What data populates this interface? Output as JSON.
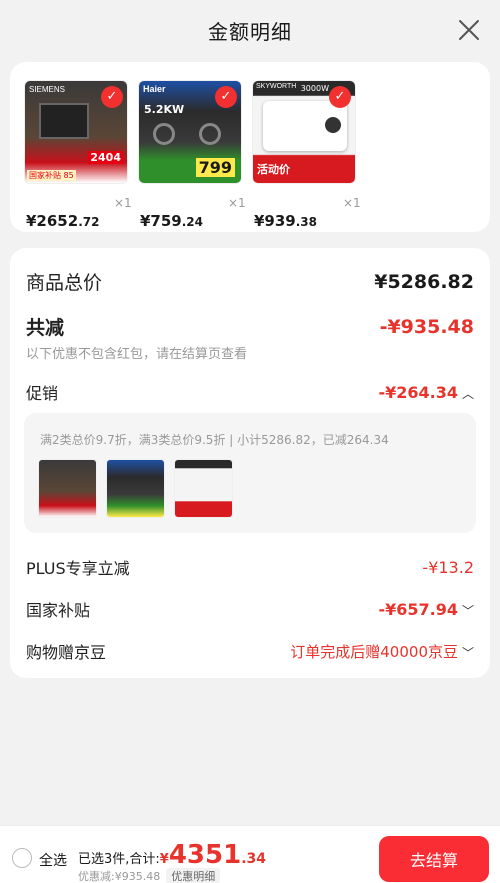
{
  "header": {
    "title": "金额明细"
  },
  "colors": {
    "accent": "#e8332c",
    "checkout": "#fa2c34"
  },
  "products": [
    {
      "name": "SIEMENS oven",
      "price_int": "¥2652",
      "price_dec": ".72",
      "qty": "×1",
      "thumb_text": "SIEMENS",
      "thumb_badge": "2404",
      "thumb_tag": "国家补贴 85"
    },
    {
      "name": "Haier gas stove",
      "price_int": "¥759",
      "price_dec": ".24",
      "qty": "×1",
      "thumb_text": "Haier",
      "thumb_badge": "5.2KW",
      "thumb_tag": "799"
    },
    {
      "name": "SKYWORTH water heater",
      "price_int": "¥939",
      "price_dec": ".38",
      "qty": "×1",
      "thumb_text": "SKYWORTH",
      "thumb_badge": "活动价",
      "thumb_tag": "3000W"
    }
  ],
  "detail": {
    "subtotal_label": "商品总价",
    "subtotal_value": "¥5286.82",
    "discount_label": "共减",
    "discount_value": "-¥935.48",
    "note": "以下优惠不包含红包，请在结算页查看",
    "promo_label": "促销",
    "promo_value": "-¥264.34",
    "promo_text": "满2类总价9.7折，满3类总价9.5折 | 小计5286.82，已减264.34",
    "plus_label": "PLUS专享立减",
    "plus_value": "-¥13.2",
    "subsidy_label": "国家补贴",
    "subsidy_value": "-¥657.94",
    "beans_label": "购物赠京豆",
    "beans_value": "订单完成后赠40000京豆"
  },
  "footer": {
    "select_all": "全选",
    "summary_prefix": "已选3件,合计:",
    "total_yen": "¥",
    "total_int": "4351",
    "total_dec": ".34",
    "saved": "优惠减:¥935.48",
    "detail_chip": "优惠明细",
    "checkout": "去结算"
  }
}
